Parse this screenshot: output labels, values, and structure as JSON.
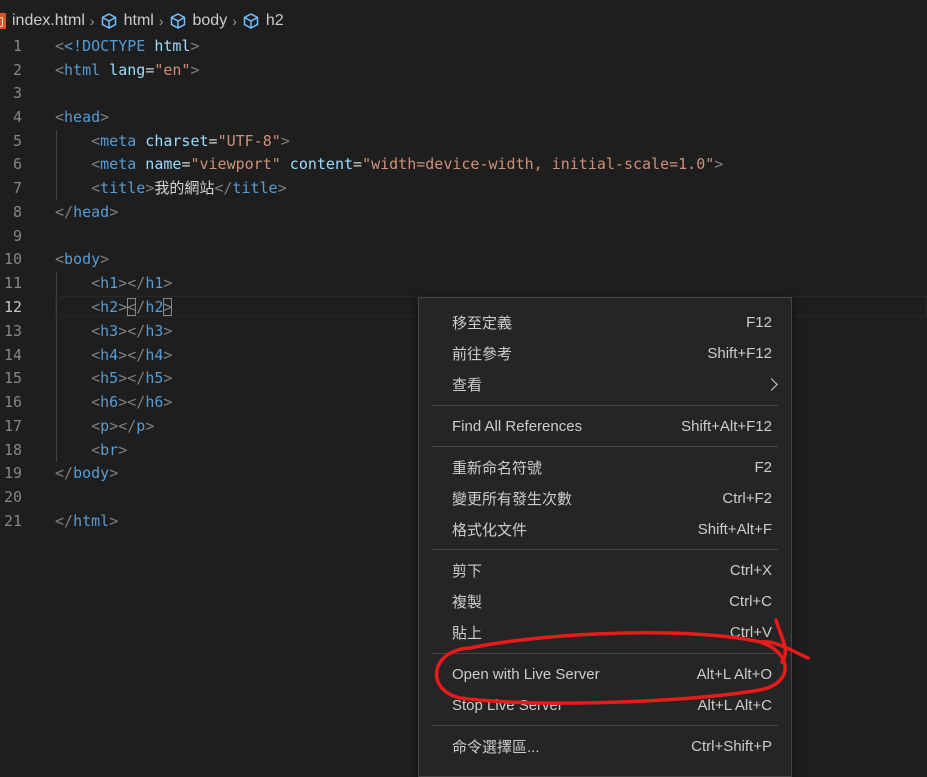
{
  "breadcrumb": {
    "file": "index.html",
    "items": [
      "html",
      "body",
      "h2"
    ]
  },
  "editor": {
    "lines": [
      {
        "n": "1"
      },
      {
        "n": "2"
      },
      {
        "n": "3"
      },
      {
        "n": "4"
      },
      {
        "n": "5"
      },
      {
        "n": "6"
      },
      {
        "n": "7"
      },
      {
        "n": "8"
      },
      {
        "n": "9"
      },
      {
        "n": "10"
      },
      {
        "n": "11"
      },
      {
        "n": "12"
      },
      {
        "n": "13"
      },
      {
        "n": "14"
      },
      {
        "n": "15"
      },
      {
        "n": "16"
      },
      {
        "n": "17"
      },
      {
        "n": "18"
      },
      {
        "n": "19"
      },
      {
        "n": "20"
      },
      {
        "n": "21"
      }
    ],
    "code": {
      "l1_doctype": "<!DOCTYPE",
      "l1_html": " html",
      "l1_end": ">",
      "l2_open": "<html",
      "l2_attr": " lang",
      "l2_eq": "=",
      "l2_val": "\"en\"",
      "l2_end": ">",
      "l4_head": "head",
      "l5_tag": "meta",
      "l5_attr": " charset",
      "l5_val": "\"UTF-8\"",
      "l6_tag": "meta",
      "l6_attr1": " name",
      "l6_val1": "\"viewport\"",
      "l6_attr2": " content",
      "l6_val2": "\"width=device-width, initial-scale=1.0\"",
      "l7_tag": "title",
      "l7_text": "我的網站",
      "l7_close": "title",
      "l8_close": "head",
      "l10_body": "body",
      "l11_open": "h1",
      "l11_close": "h1",
      "l12_open": "h2",
      "l12_close": "h2",
      "l13_open": "h3",
      "l13_close": "h3",
      "l14_open": "h4",
      "l14_close": "h4",
      "l15_open": "h5",
      "l15_close": "h5",
      "l16_open": "h6",
      "l16_close": "h6",
      "l17_open": "p",
      "l17_close": "p",
      "l18_br": "br",
      "l19_close": "body",
      "l21_close": "html"
    }
  },
  "context_menu": {
    "items": [
      {
        "label": "移至定義",
        "shortcut": "F12"
      },
      {
        "label": "前往參考",
        "shortcut": "Shift+F12"
      },
      {
        "label": "查看",
        "shortcut": ""
      },
      {
        "label": "Find All References",
        "shortcut": "Shift+Alt+F12"
      },
      {
        "label": "重新命名符號",
        "shortcut": "F2"
      },
      {
        "label": "變更所有發生次數",
        "shortcut": "Ctrl+F2"
      },
      {
        "label": "格式化文件",
        "shortcut": "Shift+Alt+F"
      },
      {
        "label": "剪下",
        "shortcut": "Ctrl+X"
      },
      {
        "label": "複製",
        "shortcut": "Ctrl+C"
      },
      {
        "label": "貼上",
        "shortcut": "Ctrl+V"
      },
      {
        "label": "Open with Live Server",
        "shortcut": "Alt+L Alt+O"
      },
      {
        "label": "Stop Live Server",
        "shortcut": "Alt+L Alt+C"
      },
      {
        "label": "命令選擇區...",
        "shortcut": "Ctrl+Shift+P"
      }
    ]
  },
  "colors": {
    "background": "#1e1e1e",
    "tag": "#569cd6",
    "attribute": "#9cdcfe",
    "string": "#ce9178",
    "menu_bg": "#252526",
    "annotation": "#e81a1a"
  }
}
